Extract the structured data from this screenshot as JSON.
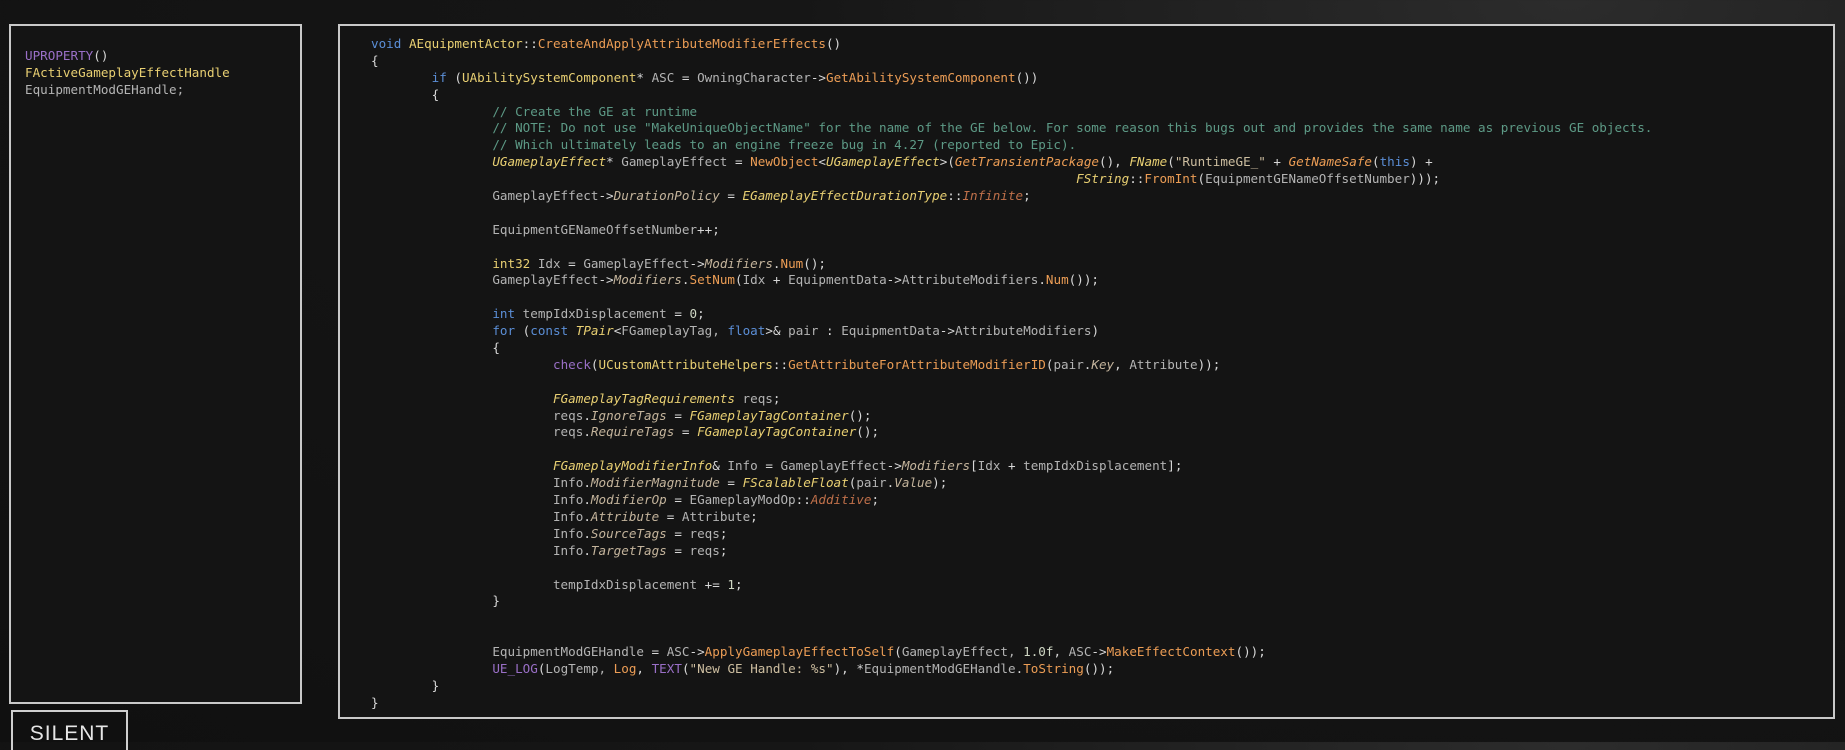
{
  "colors": {
    "background": "#141414",
    "panel_border": "#c9c9c9",
    "keyword": "#5b8ed6",
    "type": "#e8cf72",
    "function": "#ec9d55",
    "comment": "#5d9a86",
    "string": "#cdbea0",
    "enum_value": "#c0704a",
    "member": "#c4b49c",
    "macro": "#9a6fc7",
    "plain": "#b4b4b4"
  },
  "left_panel": {
    "lines": [
      [
        [
          "macro",
          "UPROPERTY"
        ],
        [
          "punct",
          "()"
        ]
      ],
      [
        [
          "type",
          "FActiveGameplayEffectHandle"
        ]
      ],
      [
        [
          "var",
          "EquipmentModGEHandle;"
        ]
      ]
    ]
  },
  "code_panel": {
    "lines": [
      [
        [
          "kw",
          "void"
        ],
        [
          "var",
          " "
        ],
        [
          "type",
          "AEquipmentActor"
        ],
        [
          "punct",
          "::"
        ],
        [
          "fn",
          "CreateAndApplyAttributeModifierEffects"
        ],
        [
          "punct",
          "()"
        ]
      ],
      [
        [
          "punct",
          "{"
        ]
      ],
      [
        [
          "var",
          "        "
        ],
        [
          "kw",
          "if"
        ],
        [
          "punct",
          " ("
        ],
        [
          "type",
          "UAbilitySystemComponent"
        ],
        [
          "punct",
          "*"
        ],
        [
          "var",
          " ASC "
        ],
        [
          "punct",
          "="
        ],
        [
          "var",
          " OwningCharacter"
        ],
        [
          "punct",
          "->"
        ],
        [
          "fn",
          "GetAbilitySystemComponent"
        ],
        [
          "punct",
          "())"
        ]
      ],
      [
        [
          "var",
          "        "
        ],
        [
          "punct",
          "{"
        ]
      ],
      [
        [
          "var",
          "                "
        ],
        [
          "comment",
          "// Create the GE at runtime"
        ]
      ],
      [
        [
          "var",
          "                "
        ],
        [
          "comment",
          "// NOTE: Do not use \"MakeUniqueObjectName\" for the name of the GE below. For some reason this bugs out and provides the same name as previous GE objects."
        ]
      ],
      [
        [
          "var",
          "                "
        ],
        [
          "comment",
          "// Which ultimately leads to an engine freeze bug in 4.27 (reported to Epic)."
        ]
      ],
      [
        [
          "var",
          "                "
        ],
        [
          "typei",
          "UGameplayEffect"
        ],
        [
          "punct",
          "*"
        ],
        [
          "var",
          " GameplayEffect "
        ],
        [
          "punct",
          "="
        ],
        [
          "var",
          " "
        ],
        [
          "fn",
          "NewObject"
        ],
        [
          "punct",
          "<"
        ],
        [
          "typei",
          "UGameplayEffect"
        ],
        [
          "punct",
          ">("
        ],
        [
          "fni",
          "GetTransientPackage"
        ],
        [
          "punct",
          "(), "
        ],
        [
          "typei",
          "FName"
        ],
        [
          "punct",
          "("
        ],
        [
          "str",
          "\"RuntimeGE_\""
        ],
        [
          "punct",
          " + "
        ],
        [
          "fni",
          "GetNameSafe"
        ],
        [
          "punct",
          "("
        ],
        [
          "kw",
          "this"
        ],
        [
          "punct",
          ") +"
        ]
      ],
      [
        [
          "var",
          "                                                                                             "
        ],
        [
          "typei",
          "FString"
        ],
        [
          "punct",
          "::"
        ],
        [
          "fn",
          "FromInt"
        ],
        [
          "punct",
          "("
        ],
        [
          "var",
          "EquipmentGENameOffsetNumber"
        ],
        [
          "punct",
          ")));"
        ]
      ],
      [
        [
          "var",
          "                GameplayEffect"
        ],
        [
          "punct",
          "->"
        ],
        [
          "member",
          "DurationPolicy"
        ],
        [
          "punct",
          " = "
        ],
        [
          "typei",
          "EGameplayEffectDurationType"
        ],
        [
          "punct",
          "::"
        ],
        [
          "enum",
          "Infinite"
        ],
        [
          "punct",
          ";"
        ]
      ],
      [],
      [
        [
          "var",
          "                EquipmentGENameOffsetNumber"
        ],
        [
          "punct",
          "++;"
        ]
      ],
      [],
      [
        [
          "var",
          "                "
        ],
        [
          "type",
          "int32"
        ],
        [
          "var",
          " Idx "
        ],
        [
          "punct",
          "="
        ],
        [
          "var",
          " GameplayEffect"
        ],
        [
          "punct",
          "->"
        ],
        [
          "member",
          "Modifiers"
        ],
        [
          "punct",
          "."
        ],
        [
          "fn",
          "Num"
        ],
        [
          "punct",
          "();"
        ]
      ],
      [
        [
          "var",
          "                GameplayEffect"
        ],
        [
          "punct",
          "->"
        ],
        [
          "member",
          "Modifiers"
        ],
        [
          "punct",
          "."
        ],
        [
          "fn",
          "SetNum"
        ],
        [
          "punct",
          "("
        ],
        [
          "var",
          "Idx "
        ],
        [
          "punct",
          "+"
        ],
        [
          "var",
          " EquipmentData"
        ],
        [
          "punct",
          "->"
        ],
        [
          "var",
          "AttributeModifiers"
        ],
        [
          "punct",
          "."
        ],
        [
          "fn",
          "Num"
        ],
        [
          "punct",
          "());"
        ]
      ],
      [],
      [
        [
          "var",
          "                "
        ],
        [
          "kw",
          "int"
        ],
        [
          "var",
          " tempIdxDisplacement "
        ],
        [
          "punct",
          "="
        ],
        [
          "num",
          " 0"
        ],
        [
          "punct",
          ";"
        ]
      ],
      [
        [
          "var",
          "                "
        ],
        [
          "kw",
          "for"
        ],
        [
          "punct",
          " ("
        ],
        [
          "kw",
          "const"
        ],
        [
          "var",
          " "
        ],
        [
          "typei",
          "TPair"
        ],
        [
          "punct",
          "<"
        ],
        [
          "var",
          "FGameplayTag, "
        ],
        [
          "kw",
          "float"
        ],
        [
          "punct",
          ">&"
        ],
        [
          "var",
          " pair "
        ],
        [
          "punct",
          ":"
        ],
        [
          "var",
          " EquipmentData"
        ],
        [
          "punct",
          "->"
        ],
        [
          "var",
          "AttributeModifiers"
        ],
        [
          "punct",
          ")"
        ]
      ],
      [
        [
          "var",
          "                "
        ],
        [
          "punct",
          "{"
        ]
      ],
      [
        [
          "var",
          "                        "
        ],
        [
          "macro",
          "check"
        ],
        [
          "punct",
          "("
        ],
        [
          "type",
          "UCustomAttributeHelpers"
        ],
        [
          "punct",
          "::"
        ],
        [
          "fn",
          "GetAttributeForAttributeModifierID"
        ],
        [
          "punct",
          "("
        ],
        [
          "var",
          "pair"
        ],
        [
          "punct",
          "."
        ],
        [
          "member",
          "Key"
        ],
        [
          "punct",
          ", "
        ],
        [
          "var",
          "Attribute"
        ],
        [
          "punct",
          "));"
        ]
      ],
      [],
      [
        [
          "var",
          "                        "
        ],
        [
          "typei",
          "FGameplayTagRequirements"
        ],
        [
          "var",
          " reqs"
        ],
        [
          "punct",
          ";"
        ]
      ],
      [
        [
          "var",
          "                        reqs"
        ],
        [
          "punct",
          "."
        ],
        [
          "member",
          "IgnoreTags"
        ],
        [
          "punct",
          " = "
        ],
        [
          "typei",
          "FGameplayTagContainer"
        ],
        [
          "punct",
          "();"
        ]
      ],
      [
        [
          "var",
          "                        reqs"
        ],
        [
          "punct",
          "."
        ],
        [
          "member",
          "RequireTags"
        ],
        [
          "punct",
          " = "
        ],
        [
          "typei",
          "FGameplayTagContainer"
        ],
        [
          "punct",
          "();"
        ]
      ],
      [],
      [
        [
          "var",
          "                        "
        ],
        [
          "typei",
          "FGameplayModifierInfo"
        ],
        [
          "punct",
          "&"
        ],
        [
          "var",
          " Info "
        ],
        [
          "punct",
          "="
        ],
        [
          "var",
          " GameplayEffect"
        ],
        [
          "punct",
          "->"
        ],
        [
          "member",
          "Modifiers"
        ],
        [
          "punct",
          "["
        ],
        [
          "var",
          "Idx "
        ],
        [
          "punct",
          "+"
        ],
        [
          "var",
          " tempIdxDisplacement"
        ],
        [
          "punct",
          "];"
        ]
      ],
      [
        [
          "var",
          "                        Info"
        ],
        [
          "punct",
          "."
        ],
        [
          "member",
          "ModifierMagnitude"
        ],
        [
          "punct",
          " = "
        ],
        [
          "typei",
          "FScalableFloat"
        ],
        [
          "punct",
          "("
        ],
        [
          "var",
          "pair"
        ],
        [
          "punct",
          "."
        ],
        [
          "member",
          "Value"
        ],
        [
          "punct",
          ");"
        ]
      ],
      [
        [
          "var",
          "                        Info"
        ],
        [
          "punct",
          "."
        ],
        [
          "member",
          "ModifierOp"
        ],
        [
          "punct",
          " = "
        ],
        [
          "var",
          "EGameplayModOp"
        ],
        [
          "punct",
          "::"
        ],
        [
          "enum",
          "Additive"
        ],
        [
          "punct",
          ";"
        ]
      ],
      [
        [
          "var",
          "                        Info"
        ],
        [
          "punct",
          "."
        ],
        [
          "member",
          "Attribute"
        ],
        [
          "punct",
          " = "
        ],
        [
          "var",
          "Attribute"
        ],
        [
          "punct",
          ";"
        ]
      ],
      [
        [
          "var",
          "                        Info"
        ],
        [
          "punct",
          "."
        ],
        [
          "member",
          "SourceTags"
        ],
        [
          "punct",
          " = "
        ],
        [
          "var",
          "reqs"
        ],
        [
          "punct",
          ";"
        ]
      ],
      [
        [
          "var",
          "                        Info"
        ],
        [
          "punct",
          "."
        ],
        [
          "member",
          "TargetTags"
        ],
        [
          "punct",
          " = "
        ],
        [
          "var",
          "reqs"
        ],
        [
          "punct",
          ";"
        ]
      ],
      [],
      [
        [
          "var",
          "                        tempIdxDisplacement "
        ],
        [
          "punct",
          "+="
        ],
        [
          "num",
          " 1"
        ],
        [
          "punct",
          ";"
        ]
      ],
      [
        [
          "var",
          "                "
        ],
        [
          "punct",
          "}"
        ]
      ],
      [],
      [],
      [
        [
          "var",
          "                EquipmentModGEHandle "
        ],
        [
          "punct",
          "="
        ],
        [
          "var",
          " ASC"
        ],
        [
          "punct",
          "->"
        ],
        [
          "fn",
          "ApplyGameplayEffectToSelf"
        ],
        [
          "punct",
          "("
        ],
        [
          "var",
          "GameplayEffect, "
        ],
        [
          "num",
          "1.0f"
        ],
        [
          "punct",
          ", "
        ],
        [
          "var",
          "ASC"
        ],
        [
          "punct",
          "->"
        ],
        [
          "fn",
          "MakeEffectContext"
        ],
        [
          "punct",
          "());"
        ]
      ],
      [
        [
          "var",
          "                "
        ],
        [
          "macro",
          "UE_LOG"
        ],
        [
          "punct",
          "("
        ],
        [
          "var",
          "LogTemp, "
        ],
        [
          "fn",
          "Log"
        ],
        [
          "punct",
          ", "
        ],
        [
          "macro",
          "TEXT"
        ],
        [
          "punct",
          "("
        ],
        [
          "str",
          "\"New GE Handle: %s\""
        ],
        [
          "punct",
          "), *"
        ],
        [
          "var",
          "EquipmentModGEHandle"
        ],
        [
          "punct",
          "."
        ],
        [
          "fn",
          "ToString"
        ],
        [
          "punct",
          "());"
        ]
      ],
      [
        [
          "var",
          "        "
        ],
        [
          "punct",
          "}"
        ]
      ],
      [
        [
          "punct",
          "}"
        ]
      ]
    ]
  },
  "badge": {
    "label": "SILENT"
  }
}
